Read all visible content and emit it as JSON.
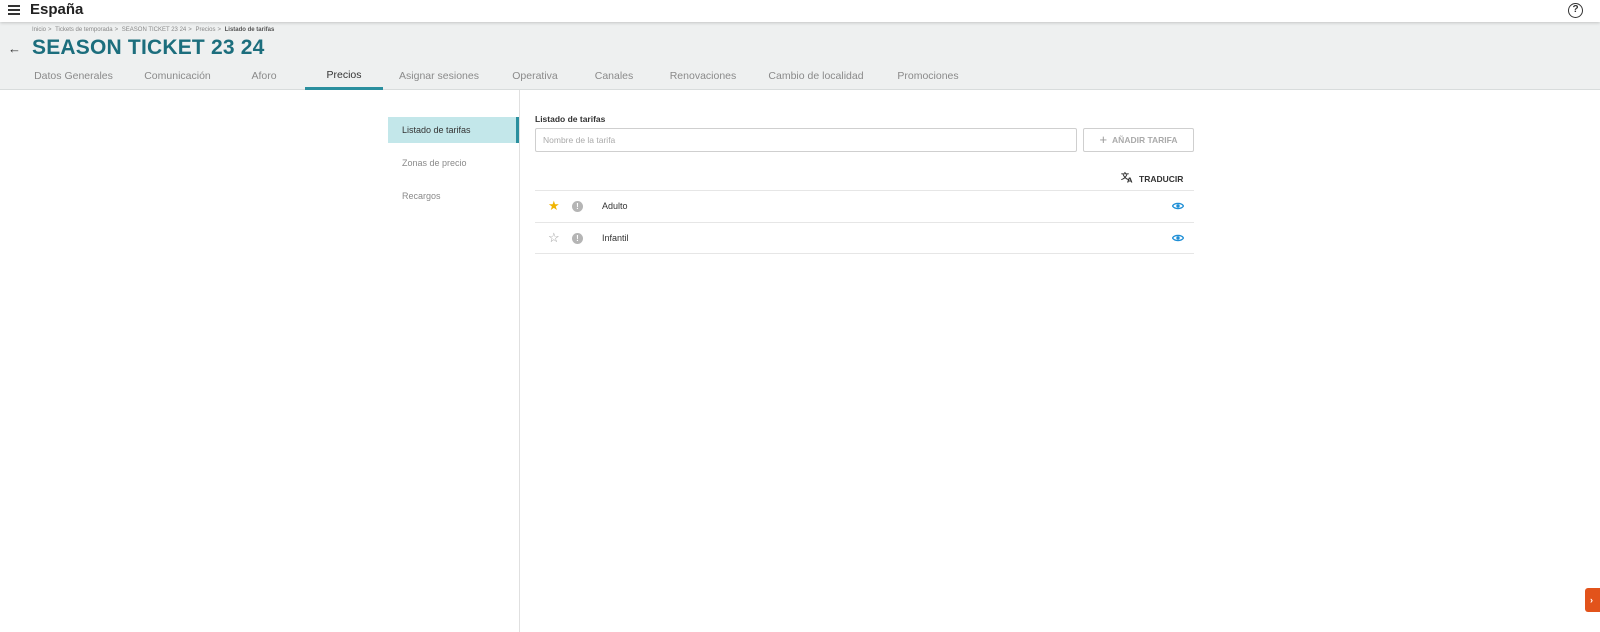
{
  "app": {
    "title": "España"
  },
  "breadcrumb": [
    "Inicio",
    "Tickets de temporada",
    "SEASON TICKET 23 24",
    "Precios",
    "Listado de tarifas"
  ],
  "page": {
    "title": "SEASON TICKET 23 24"
  },
  "tabs": [
    {
      "label": "Datos Generales",
      "active": false
    },
    {
      "label": "Comunicación",
      "active": false
    },
    {
      "label": "Aforo",
      "active": false
    },
    {
      "label": "Precios",
      "active": true
    },
    {
      "label": "Asignar sesiones",
      "active": false
    },
    {
      "label": "Operativa",
      "active": false
    },
    {
      "label": "Canales",
      "active": false
    },
    {
      "label": "Renovaciones",
      "active": false
    },
    {
      "label": "Cambio de localidad",
      "active": false
    },
    {
      "label": "Promociones",
      "active": false
    }
  ],
  "sidenav": {
    "items": [
      {
        "label": "Listado de tarifas",
        "active": true
      },
      {
        "label": "Zonas de precio",
        "active": false
      },
      {
        "label": "Recargos",
        "active": false
      }
    ]
  },
  "rates": {
    "section_label": "Listado de tarifas",
    "input_placeholder": "Nombre de la tarifa",
    "add_button_label": "AÑADIR TARIFA",
    "translate_label": "TRADUCIR",
    "items": [
      {
        "name": "Adulto",
        "default": true
      },
      {
        "name": "Infantil",
        "default": false
      }
    ]
  },
  "colors": {
    "accent": "#2a8f9e",
    "title": "#1c6e7d",
    "star": "#f0b400",
    "eye": "#1f8fd6",
    "chat_widget": "#e2531b"
  },
  "icons": {
    "menu": "menu-icon",
    "help": "help-icon",
    "back": "back-arrow-icon",
    "translate": "translate-icon",
    "star": "star-icon",
    "info": "info-icon",
    "visibility": "eye-icon",
    "add": "plus-icon"
  }
}
